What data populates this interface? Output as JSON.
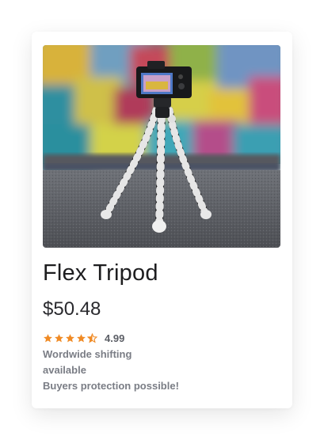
{
  "product": {
    "title": "Flex Tripod",
    "price": "$50.48",
    "rating": {
      "value": "4.99",
      "stars_filled": 4.5,
      "stars_total": 5,
      "star_color": "#f08a24"
    },
    "shipping_line1": "Wordwide shifting",
    "shipping_line2": "available",
    "protection": "Buyers protection possible!",
    "image_icon": "camera-on-flexible-tripod-photo"
  }
}
